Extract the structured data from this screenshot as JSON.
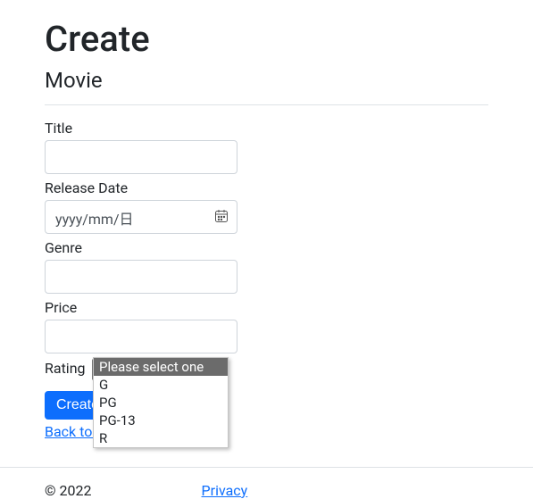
{
  "heading": "Create",
  "subtitle": "Movie",
  "form": {
    "title_label": "Title",
    "release_date_label": "Release Date",
    "release_date_placeholder": "yyyy/mm/日",
    "genre_label": "Genre",
    "price_label": "Price",
    "rating_label": "Rating",
    "rating_selected": "Please select one",
    "rating_options": {
      "0": "Please select one",
      "1": "G",
      "2": "PG",
      "3": "PG-13",
      "4": "R"
    },
    "submit_label": "Create"
  },
  "back_link": "Back to List",
  "footer": {
    "copyright": "© 2022",
    "privacy": "Privacy"
  }
}
